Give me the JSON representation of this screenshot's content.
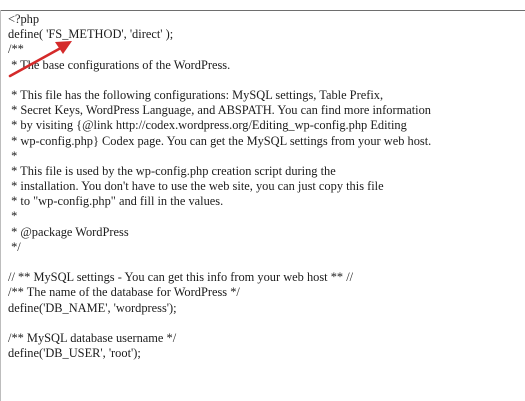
{
  "editor": {
    "lines": [
      "<?php",
      "define( 'FS_METHOD', 'direct' );",
      "/**",
      " * The base configurations of the WordPress.",
      "",
      " * This file has the following configurations: MySQL settings, Table Prefix,",
      " * Secret Keys, WordPress Language, and ABSPATH. You can find more information",
      " * by visiting {@link http://codex.wordpress.org/Editing_wp-config.php Editing",
      " * wp-config.php} Codex page. You can get the MySQL settings from your web host.",
      " *",
      " * This file is used by the wp-config.php creation script during the",
      " * installation. You don't have to use the web site, you can just copy this file",
      " * to \"wp-config.php\" and fill in the values.",
      " *",
      " * @package WordPress",
      " */",
      "",
      "// ** MySQL settings - You can get this info from your web host ** //",
      "/** The name of the database for WordPress */",
      "define('DB_NAME', 'wordpress');",
      "",
      "/** MySQL database username */",
      "define('DB_USER', 'root');"
    ]
  },
  "annotation": {
    "color": "#d42a2a",
    "icon": "arrow-icon"
  }
}
